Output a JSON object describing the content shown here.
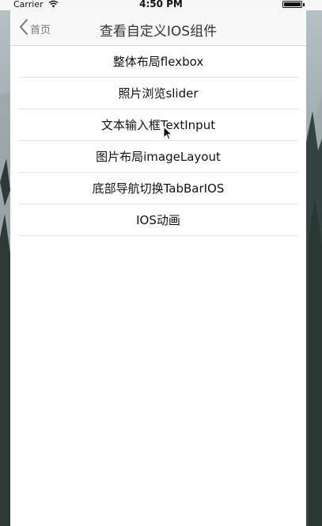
{
  "status_bar": {
    "carrier": "Carrier",
    "time": "4:50 PM"
  },
  "nav": {
    "back_label": "首页",
    "title": "查看自定义IOS组件"
  },
  "menu": {
    "items": [
      {
        "label": "整体布局flexbox"
      },
      {
        "label": "照片浏览slider"
      },
      {
        "label": "文本输入框TextInput"
      },
      {
        "label": "图片布局imageLayout"
      },
      {
        "label": "底部导航切换TabBarIOS"
      },
      {
        "label": "IOS动画"
      }
    ]
  },
  "icons": {
    "back": "chevron-left-icon",
    "wifi": "wifi-icon",
    "battery": "battery-icon",
    "cursor": "mouse-pointer-icon"
  },
  "colors": {
    "nav_background": "#f8f8f8",
    "list_background": "#ffffff",
    "divider": "#e3e3e3"
  }
}
